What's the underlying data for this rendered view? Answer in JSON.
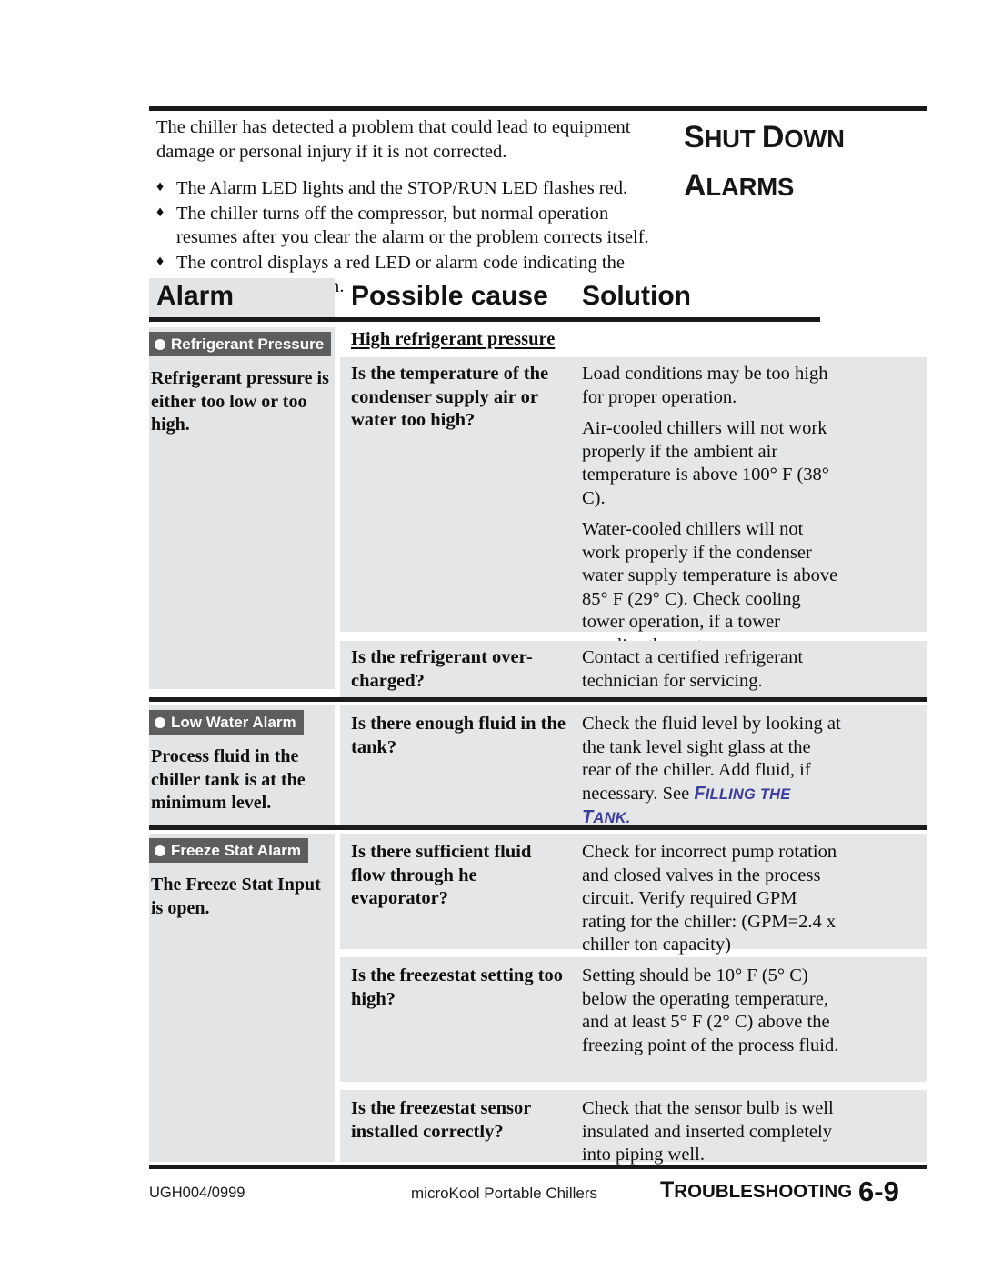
{
  "section": {
    "title_line1_cap": "S",
    "title_line1_rest": "HUT ",
    "title_line1_cap2": "D",
    "title_line1_rest2": "OWN",
    "title_line2_cap": "A",
    "title_line2_rest": "LARMS"
  },
  "intro": {
    "lead": "The chiller has detected a problem that could lead to equipment damage or personal injury if it is not corrected.",
    "bullet_glyph": "♦",
    "bullets": [
      "The Alarm LED lights and the STOP/RUN LED flashes red.",
      "The chiller turns off the compressor, but normal operation resumes after you clear the alarm or the problem corrects itself.",
      "The control displays a red LED or alarm code indicating the source of the problem."
    ]
  },
  "table": {
    "headers": {
      "alarm": "Alarm",
      "cause": "Possible cause",
      "solution": "Solution"
    },
    "groups": [
      {
        "badge_label": "Refrigerant Pressure",
        "alarm_description": "Refrigerant pressure is either too low or too high.",
        "subheading": "High refrigerant pressure",
        "rows": [
          {
            "cause": "Is the temperature of the condenser supply air or water too high?",
            "solution_paragraphs": [
              "Load conditions may be too high for proper operation.",
              "Air-cooled chillers will not work properly if the ambient air temperature is above 100° F (38° C).",
              "Water-cooled chillers will not work properly if the condenser water supply temperature is above 85° F (29° C). Check cooling tower operation, if a tower supplies the water."
            ]
          },
          {
            "cause": "Is the refrigerant over-charged?",
            "solution_paragraphs": [
              "Contact a certified refrigerant technician for servicing."
            ]
          }
        ]
      },
      {
        "badge_label": "Low Water Alarm",
        "alarm_description": "Process fluid in the chiller tank is at the minimum level.",
        "subheading": "",
        "rows": [
          {
            "cause": "Is there enough fluid in the tank?",
            "solution_paragraphs": [
              "Check the fluid level by looking at the tank level sight glass at the rear of the chiller. Add fluid, if necessary. See "
            ],
            "xref": {
              "part1_cap": "F",
              "part1_sc": "ILLING",
              "part2_sc": "THE ",
              "part2_cap": "T",
              "part2_sc2": "ANK."
            }
          }
        ]
      },
      {
        "badge_label": "Freeze Stat Alarm",
        "alarm_description": "The Freeze Stat Input is open.",
        "subheading": "",
        "rows": [
          {
            "cause": "Is there sufficient fluid flow through he evaporator?",
            "solution_paragraphs": [
              "Check for incorrect pump rotation and closed valves in the process circuit. Verify required GPM rating for the chiller: (GPM=2.4 x chiller ton capacity)"
            ]
          },
          {
            "cause": "Is the freezestat setting too high?",
            "solution_paragraphs": [
              "Setting should be 10° F (5° C) below the operating temperature, and at least 5° F (2° C) above the freezing point of the process fluid."
            ]
          },
          {
            "cause": "Is the freezestat sensor installed correctly?",
            "solution_paragraphs": [
              "Check that the sensor bulb is well insulated and inserted completely into piping well."
            ]
          }
        ]
      }
    ]
  },
  "footer": {
    "doc_code": "UGH004/0999",
    "product": "microKool Portable Chillers",
    "section_cap": "T",
    "section_sc": "ROUBLESHOOTING",
    "page_number": "6-9"
  },
  "colors": {
    "rule": "#1a1a1a",
    "cell_gray": "#e5e6e7",
    "alarm_gray": "#e3e4e5",
    "badge_gray": "#5d5d5d",
    "xref_blue": "#3d3d9e"
  }
}
